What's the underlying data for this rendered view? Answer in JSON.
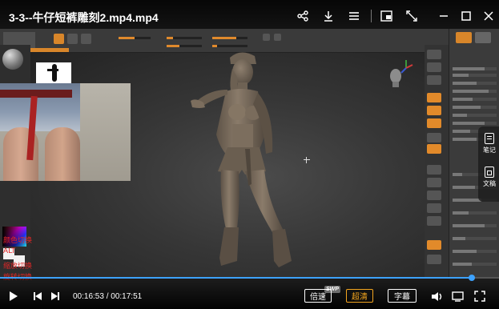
{
  "player": {
    "title": "3-3--牛仔短裤雕刻2.mp4.mp4",
    "current_time": "00:16:53",
    "total_time": "00:17:51",
    "time_separator": "/",
    "progress": 0.946,
    "speed_label": "倍速",
    "quality_label": "超清",
    "subtitle_label": "字幕",
    "swp_badge": "SWP",
    "accent_color": "#3da2ff",
    "quality_color": "#f3a51f"
  },
  "top_icons": [
    "share-icon",
    "download-icon",
    "menu-icon",
    "picture-in-picture-icon",
    "minimize-icon",
    "maximize-icon",
    "close-icon"
  ],
  "side_dock": {
    "notes_label": "笔记",
    "doc_label": "文稿"
  },
  "overlay_notes": [
    "颜色切换",
    "ALT",
    "缩放切换",
    "旋转切换"
  ]
}
